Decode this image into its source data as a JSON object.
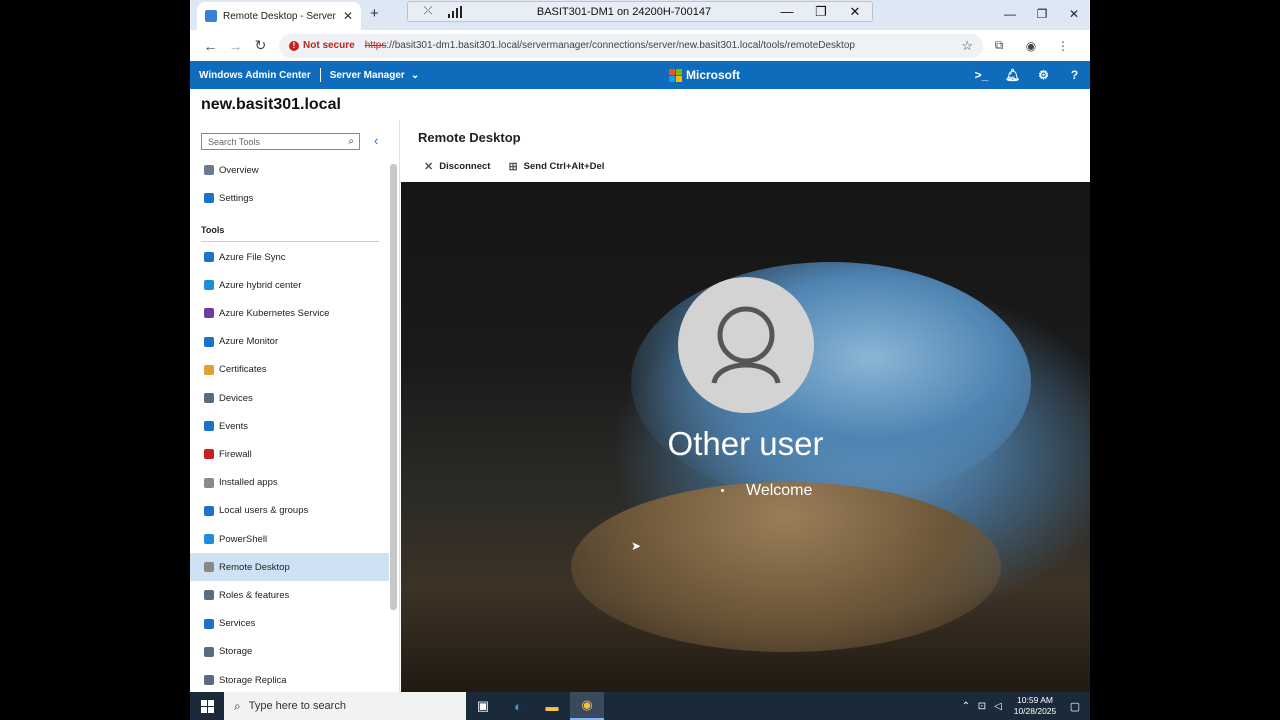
{
  "browser": {
    "tab_title": "Remote Desktop - Server Mana",
    "tab_close": "✕",
    "new_tab": "+",
    "rdp_title": "BASIT301-DM1 on 24200H-700147",
    "not_secure": "Not secure",
    "url_proto": "https",
    "url_rest": "://basit301-dm1.basit301.local/servermanager/connections/server/new.basit301.local/tools/remoteDesktop"
  },
  "header": {
    "app_name": "Windows Admin Center",
    "server_manager": "Server Manager",
    "brand": "Microsoft"
  },
  "server_name": "new.basit301.local",
  "sidebar": {
    "search_placeholder": "Search Tools",
    "items": [
      {
        "label": "Overview",
        "color": "#6b7a8f"
      },
      {
        "label": "Settings",
        "color": "#1a73c8"
      }
    ],
    "tools_label": "Tools",
    "tools": [
      {
        "label": "Azure File Sync",
        "color": "#1a73c8"
      },
      {
        "label": "Azure hybrid center",
        "color": "#1a8fd8"
      },
      {
        "label": "Azure Kubernetes Service",
        "color": "#6b3fa0"
      },
      {
        "label": "Azure Monitor",
        "color": "#1a73c8"
      },
      {
        "label": "Certificates",
        "color": "#e0a030"
      },
      {
        "label": "Devices",
        "color": "#5a6b80"
      },
      {
        "label": "Events",
        "color": "#1a73c8"
      },
      {
        "label": "Firewall",
        "color": "#c5221f"
      },
      {
        "label": "Installed apps",
        "color": "#8a8a8a"
      },
      {
        "label": "Local users & groups",
        "color": "#1a73c8"
      },
      {
        "label": "PowerShell",
        "color": "#1a8fd8"
      },
      {
        "label": "Remote Desktop",
        "color": "#888888"
      },
      {
        "label": "Roles & features",
        "color": "#5a6b80"
      },
      {
        "label": "Services",
        "color": "#1a73c8"
      },
      {
        "label": "Storage",
        "color": "#5a6b80"
      },
      {
        "label": "Storage Replica",
        "color": "#5a6b80"
      }
    ]
  },
  "main": {
    "title": "Remote Desktop",
    "disconnect": "Disconnect",
    "send_cad": "Send Ctrl+Alt+Del",
    "login_user": "Other user",
    "login_status": "Welcome"
  },
  "taskbar": {
    "search_placeholder": "Type here to search",
    "time": "10:59 AM",
    "date": "10/28/2025"
  }
}
